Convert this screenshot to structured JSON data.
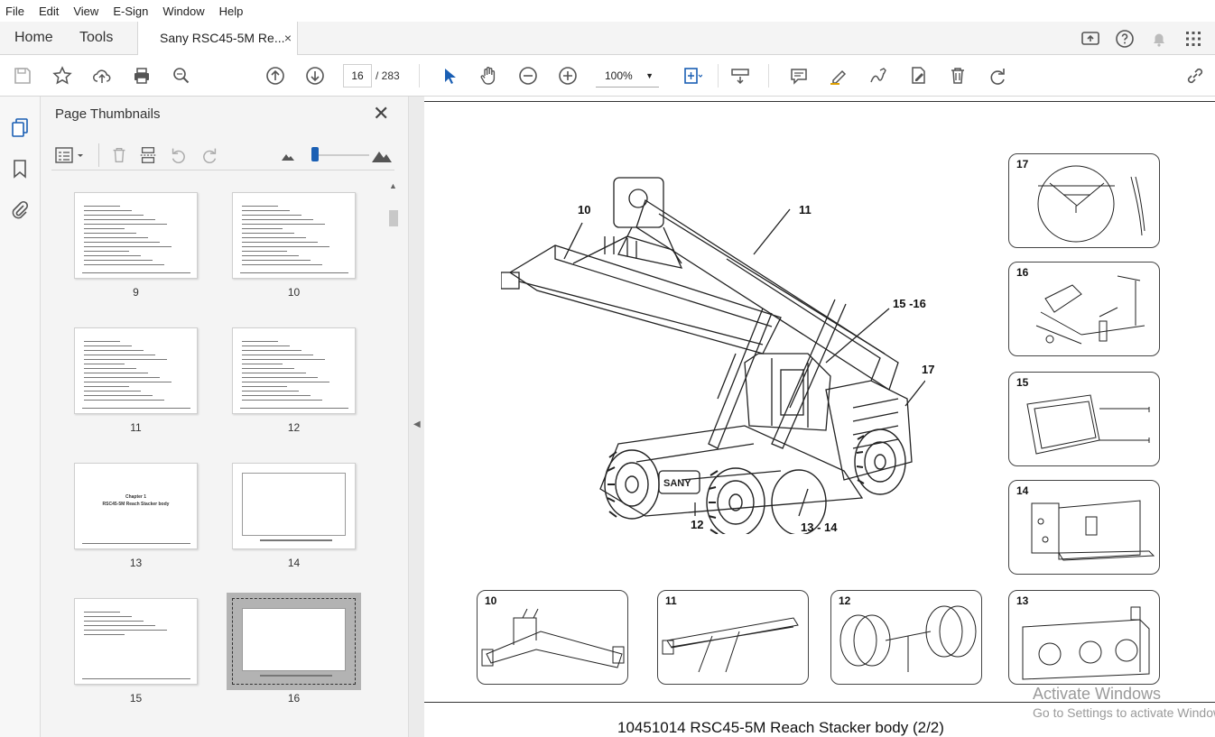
{
  "menu": [
    "File",
    "Edit",
    "View",
    "E-Sign",
    "Window",
    "Help"
  ],
  "tabs": {
    "home": "Home",
    "tools": "Tools",
    "document": "Sany RSC45-5M Re...",
    "close": "×"
  },
  "toolbar": {
    "page_current": "16",
    "page_total": "/ 283",
    "zoom": "100%"
  },
  "panel": {
    "title": "Page Thumbnails",
    "thumbnails": [
      {
        "page": "9"
      },
      {
        "page": "10"
      },
      {
        "page": "11"
      },
      {
        "page": "12"
      },
      {
        "page": "13",
        "chapter": "Chapter 1",
        "subtitle": "RSC45-5M Reach Stacker body"
      },
      {
        "page": "14"
      },
      {
        "page": "15"
      },
      {
        "page": "16"
      }
    ]
  },
  "document": {
    "callouts": [
      "10",
      "11",
      "15 -16",
      "17",
      "12",
      "13 - 14"
    ],
    "details": [
      "17",
      "16",
      "15",
      "14",
      "10",
      "11",
      "12",
      "13"
    ],
    "logo": "SANY",
    "caption": "10451014 RSC45-5M Reach Stacker body (2/2)"
  },
  "watermark": {
    "line1": "Activate Windows",
    "line2": "Go to Settings to activate Windows."
  }
}
